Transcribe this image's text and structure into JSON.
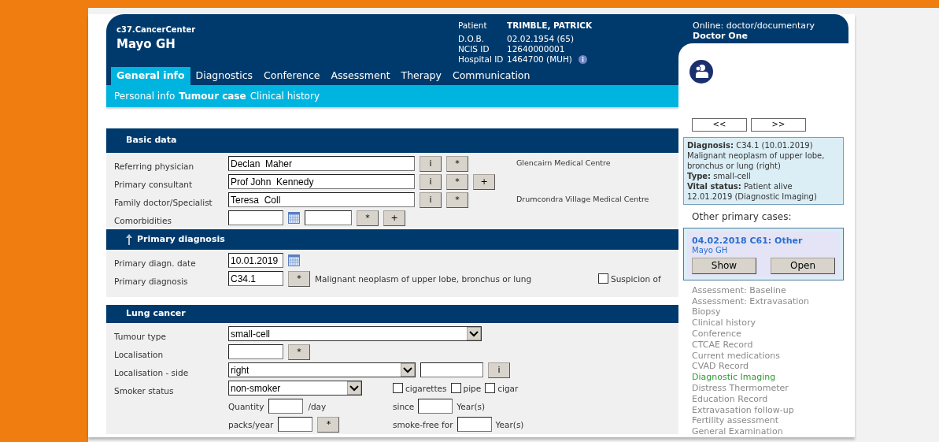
{
  "header": {
    "organisation": "c37.CancerCenter",
    "site": "Mayo GH",
    "patient": [
      {
        "label": "Patient",
        "value": "TRIMBLE, PATRICK",
        "kind": "name"
      },
      {
        "label": "D.O.B.",
        "value": "02.02.1954 (65)",
        "kind": "plain"
      },
      {
        "label": "NCIS ID",
        "value": "12640000001",
        "kind": "plain"
      },
      {
        "label": "Hospital ID",
        "value": "1464700 (MUH)",
        "kind": "info"
      }
    ],
    "online": "Online: doctor/documentary",
    "user": "Doctor One"
  },
  "tabs": [
    {
      "label": "General info",
      "selected": true
    },
    {
      "label": "Diagnostics",
      "selected": false
    },
    {
      "label": "Conference",
      "selected": false
    },
    {
      "label": "Assessment",
      "selected": false
    },
    {
      "label": "Therapy",
      "selected": false
    },
    {
      "label": "Communication",
      "selected": false
    }
  ],
  "subtabs": [
    {
      "label": "Personal info",
      "selected": false
    },
    {
      "label": "Tumour case",
      "selected": true
    },
    {
      "label": "Clinical history",
      "selected": false
    }
  ],
  "sections": [
    {
      "title": "Basic data",
      "kind": "basic",
      "collapse_arrow": false,
      "rows": [
        {
          "label": "Referring physician",
          "items": [
            {
              "kind": "input",
              "value": "Declan  Maher"
            },
            {
              "kind": "button",
              "label": "i"
            },
            {
              "kind": "button",
              "label": "*"
            }
          ],
          "aside": [
            {
              "kind": "note",
              "text": "Glencairn Medical Centre"
            }
          ]
        },
        {
          "label": "Primary consultant",
          "items": [
            {
              "kind": "input",
              "value": "Prof John  Kennedy"
            },
            {
              "kind": "button",
              "label": "i"
            },
            {
              "kind": "button",
              "label": "*"
            },
            {
              "kind": "button",
              "label": "+"
            }
          ]
        },
        {
          "label": "Family doctor/Specialist",
          "items": [
            {
              "kind": "input",
              "value": "Teresa  Coll"
            },
            {
              "kind": "button",
              "label": "i"
            },
            {
              "kind": "button",
              "label": "*"
            }
          ],
          "aside": [
            {
              "kind": "note",
              "text": "Drumcondra Village Medical Centre"
            }
          ]
        },
        {
          "label": "Comorbidities",
          "items": [
            {
              "kind": "short-input"
            },
            {
              "kind": "calendar"
            },
            {
              "kind": "medium-input"
            },
            {
              "kind": "button",
              "label": "*"
            },
            {
              "kind": "button",
              "label": "+"
            }
          ]
        }
      ]
    },
    {
      "title": "Primary diagnosis",
      "kind": "diagnosis",
      "collapse_arrow": true,
      "rows": [
        {
          "label": "Primary diagn. date",
          "items": [
            {
              "kind": "short-input",
              "value": "10.01.2019"
            },
            {
              "kind": "calendar"
            }
          ]
        },
        {
          "label": "Primary diagnosis",
          "items": [
            {
              "kind": "short-input",
              "value": "C34.1"
            },
            {
              "kind": "button",
              "label": "*"
            },
            {
              "kind": "text",
              "text": "Malignant neoplasm of upper lobe, bronchus or lung"
            }
          ],
          "aside": [
            {
              "kind": "checkbox",
              "label": "Suspicion of",
              "checked": false
            }
          ]
        }
      ]
    },
    {
      "title": "Lung cancer",
      "kind": "lung",
      "collapse_arrow": false,
      "rows": [
        {
          "label": "Tumour type",
          "items": [
            {
              "kind": "wide-select",
              "value": "small-cell"
            }
          ]
        },
        {
          "label": "Localisation",
          "items": [
            {
              "kind": "short-input"
            },
            {
              "kind": "button",
              "label": "*"
            }
          ]
        },
        {
          "label": "Localisation - side",
          "items": [
            {
              "kind": "medium-select",
              "value": "right"
            },
            {
              "kind": "side-input"
            },
            {
              "kind": "button",
              "label": "i"
            }
          ]
        },
        {
          "label": "Smoker status",
          "items": [
            {
              "kind": "short-select",
              "value": "non-smoker"
            }
          ],
          "aside": [
            {
              "kind": "checkbox",
              "label": "cigarettes",
              "checked": false
            },
            {
              "kind": "checkbox",
              "label": "pipe",
              "checked": false
            },
            {
              "kind": "checkbox",
              "label": "cigar",
              "checked": false
            }
          ]
        },
        {
          "items": [
            {
              "kind": "text",
              "text": "Quantity"
            },
            {
              "kind": "mini-input"
            },
            {
              "kind": "text",
              "text": "/day"
            }
          ],
          "aside": [
            {
              "kind": "text",
              "text": "since"
            },
            {
              "kind": "mini-input"
            },
            {
              "kind": "text",
              "text": "Year(s)"
            }
          ]
        },
        {
          "items": [
            {
              "kind": "text",
              "text": "packs/year"
            },
            {
              "kind": "mini-input"
            },
            {
              "kind": "button",
              "label": "*"
            }
          ],
          "aside": [
            {
              "kind": "text",
              "text": "smoke-free for"
            },
            {
              "kind": "mini-input"
            },
            {
              "kind": "text",
              "text": "Year(s)"
            }
          ]
        }
      ]
    }
  ],
  "side": {
    "nav": [
      "<<",
      ">>"
    ],
    "summary": [
      "**Diagnosis:** C34.1 (10.01.2019)",
      "Malignant neoplasm of upper lobe,",
      "bronchus or lung (right)",
      "**Type:** small-cell",
      "**Vital status:** Patient alive",
      "12.01.2019 (Diagnostic Imaging)"
    ],
    "other_title": "Other primary cases:",
    "other_case": {
      "title": "04.02.2018 C61: Other",
      "site": "Mayo GH",
      "buttons": [
        "Show",
        "Open"
      ]
    },
    "records": [
      {
        "label": "Assessment: Baseline",
        "selected": false
      },
      {
        "label": "Assessment: Extravasation",
        "selected": false
      },
      {
        "label": "Biopsy",
        "selected": false
      },
      {
        "label": "Clinical history",
        "selected": false
      },
      {
        "label": "Conference",
        "selected": false
      },
      {
        "label": "CTCAE Record",
        "selected": false
      },
      {
        "label": "Current medications",
        "selected": false
      },
      {
        "label": "CVAD Record",
        "selected": false
      },
      {
        "label": "Diagnostic Imaging",
        "selected": true
      },
      {
        "label": "Distress Thermometer",
        "selected": false
      },
      {
        "label": "Education Record",
        "selected": false
      },
      {
        "label": "Extravasation follow-up",
        "selected": false
      },
      {
        "label": "Fertility assessment",
        "selected": false
      },
      {
        "label": "General Examination",
        "selected": false
      }
    ]
  }
}
